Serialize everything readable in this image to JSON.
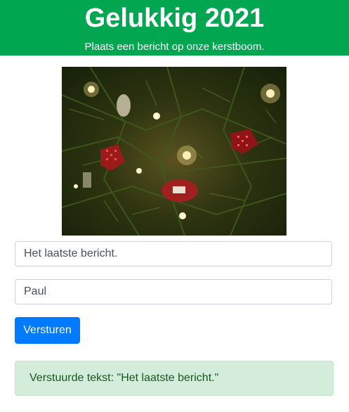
{
  "header": {
    "title": "Gelukkig 2021",
    "subtitle": "Plaats een bericht op onze kerstboom."
  },
  "colors": {
    "header_bg": "#00a650",
    "button_bg": "#007bff",
    "alert_bg": "#d4edda",
    "alert_text": "#155724"
  },
  "form": {
    "message_value": "Het laatste bericht.",
    "name_value": "Paul",
    "submit_label": "Versturen"
  },
  "alert": {
    "text": "Verstuurde tekst: \"Het laatste bericht.\""
  }
}
